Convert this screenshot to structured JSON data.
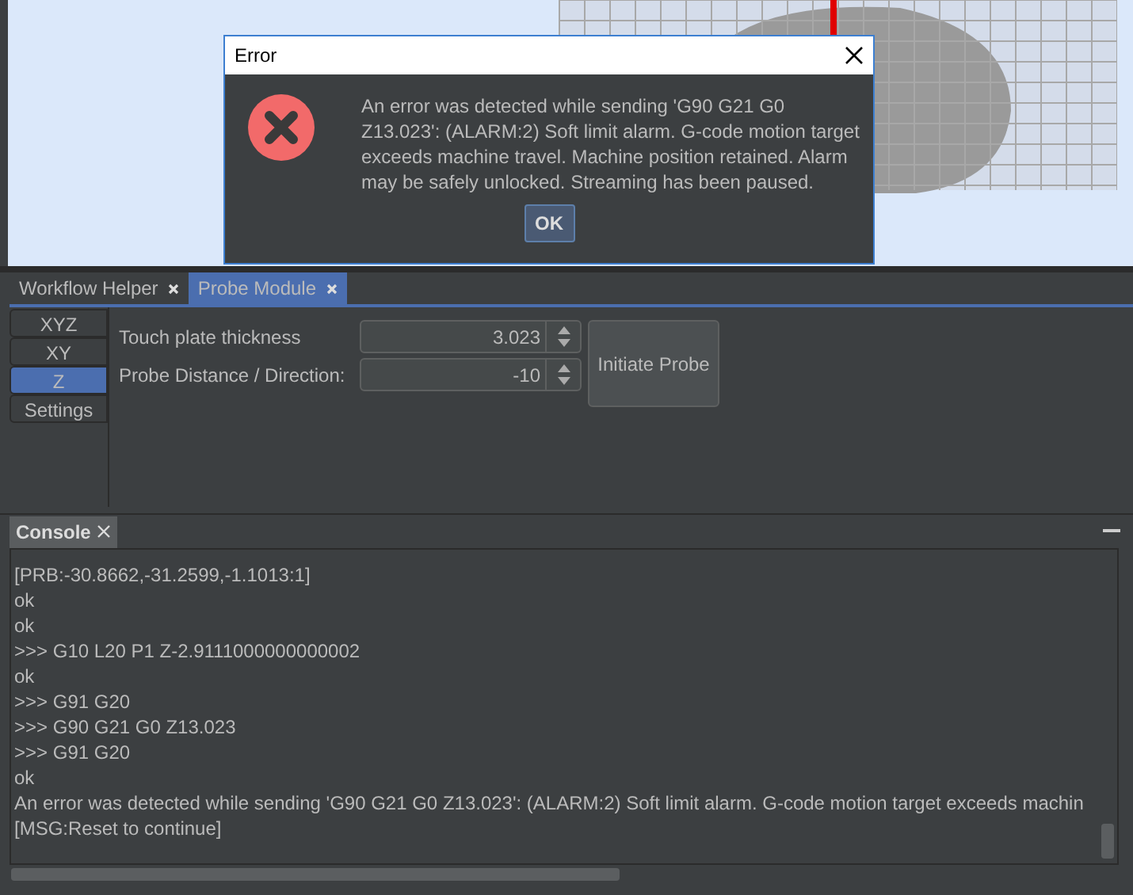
{
  "dialog": {
    "title": "Error",
    "message": "An error was detected while sending 'G90 G21 G0 Z13.023': (ALARM:2) Soft limit alarm. G-code motion target exceeds machine travel. Machine position retained. Alarm may be safely unlocked. Streaming has been paused.",
    "button": "OK"
  },
  "module_tabs": [
    {
      "label": "Workflow Helper",
      "selected": false
    },
    {
      "label": "Probe Module",
      "selected": true
    }
  ],
  "probe_tabs": [
    {
      "label": "XYZ",
      "selected": false
    },
    {
      "label": "XY",
      "selected": false
    },
    {
      "label": "Z",
      "selected": true
    },
    {
      "label": "Settings",
      "selected": false
    }
  ],
  "fields": [
    {
      "label": "Touch plate thickness",
      "value": "3.023"
    },
    {
      "label": "Probe Distance / Direction:",
      "value": "-10"
    }
  ],
  "probe_button": "Initiate Probe",
  "console": {
    "title": "Console",
    "lines": [
      "[PRB:-30.8662,-31.2599,-1.1013:1]",
      "ok",
      "ok",
      ">>> G10 L20 P1 Z-2.9111000000000002",
      "ok",
      ">>> G91 G20",
      ">>> G90 G21 G0 Z13.023",
      ">>> G91 G20",
      "ok",
      "An error was detected while sending 'G90 G21 G0 Z13.023': (ALARM:2) Soft limit alarm. G-code motion target exceeds machin",
      "[MSG:Reset to continue]"
    ]
  }
}
